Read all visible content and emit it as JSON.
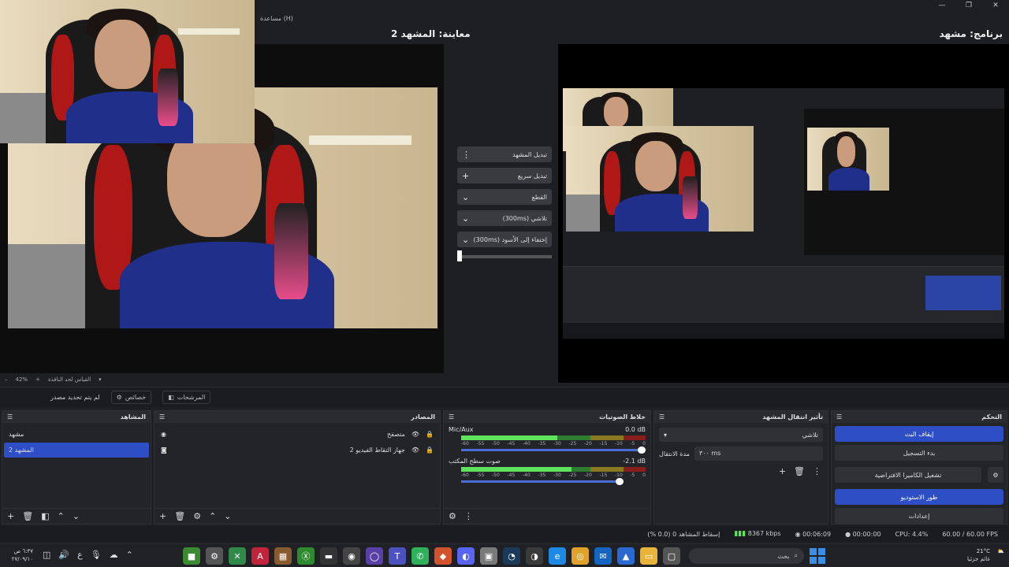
{
  "window": {
    "controls": [
      "—",
      "❐",
      "✕"
    ]
  },
  "menu": {
    "help": "مساعدة (H)"
  },
  "preview": {
    "title": "معاينة: المشهد 2",
    "zoom": "42%",
    "zoom_label": "القياس لحد النافذة"
  },
  "program": {
    "title": "برنامج: مشهد"
  },
  "transition_controls": {
    "quick_switch": "تبديل المشهد",
    "quick_add": "تبديل سريع",
    "cut": "القطع",
    "fade": "تلاشي (300ms)",
    "fade_black": "إختفاء إلى الأسود (300ms)"
  },
  "toolbar": {
    "no_source": "لم يتم تحديد مصدر",
    "properties": "خصائص",
    "filters": "المرشحات"
  },
  "scenes": {
    "title": "المشاهد",
    "items": [
      {
        "label": "مشهد"
      },
      {
        "label": "المشهد 2"
      }
    ]
  },
  "sources": {
    "title": "المصادر",
    "items": [
      {
        "label": "متصفح"
      },
      {
        "label": "جهاز التقاط الفيديو 2"
      }
    ]
  },
  "mixer": {
    "title": "خلاط الصوتيات",
    "channels": [
      {
        "name": "Mic/Aux",
        "db": "0.0 dB",
        "level": 0.52
      },
      {
        "name": "صوت سطح المكتب",
        "db": "-2.1 dB",
        "level": 0.6
      }
    ],
    "ticks": [
      "-60",
      "-55",
      "-50",
      "-45",
      "-40",
      "-35",
      "-30",
      "-25",
      "-20",
      "-15",
      "-10",
      "-5",
      "0"
    ]
  },
  "transitions": {
    "title": "تأثير انتقال المشهد",
    "selected": "تلاشي",
    "duration_label": "مدة الانتقال",
    "duration_value": "٣٠٠ ms"
  },
  "controls": {
    "title": "التحكم",
    "stop_stream": "إيقاف البث",
    "start_record": "بدء التسجيل",
    "virtual_cam": "تشغيل الكاميرا الافتراضية",
    "studio_mode": "طور الاستوديو",
    "settings": "إعدادات"
  },
  "status": {
    "dropped": "إسقاط المشاهد 0 (0.0 %)",
    "bitrate": "8367 kbps",
    "stream_time": "00:06:09",
    "rec_time": "00:00:00",
    "cpu": "CPU: 4.4%",
    "fps": "60.00 / 60.00 FPS"
  },
  "taskbar": {
    "time": "٦:٣٧ ص",
    "date": "٢٧/٠٩/١٠",
    "lang": "ع",
    "search": "بحث",
    "weather_temp": "21°C",
    "weather_desc": "غائم جزئيا"
  },
  "colors": {
    "accent": "#2d4ec5",
    "meter_green": "#5fe35f",
    "bg": "#1e1f22"
  }
}
